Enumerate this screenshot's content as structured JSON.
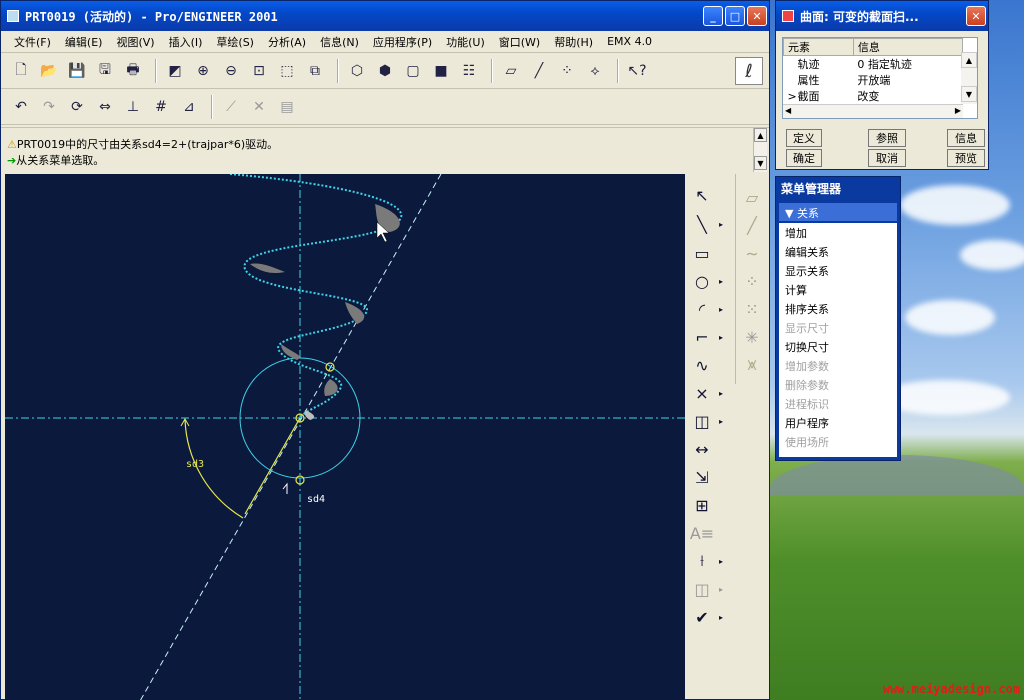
{
  "main_window": {
    "title": "PRT0019 (活动的) - Pro/ENGINEER 2001",
    "menus": [
      "文件(F)",
      "编辑(E)",
      "视图(V)",
      "插入(I)",
      "草绘(S)",
      "分析(A)",
      "信息(N)",
      "应用程序(P)",
      "功能(U)",
      "窗口(W)",
      "帮助(H)",
      "EMX 4.0"
    ],
    "messages": {
      "line1": "PRT0019中的尺寸由关系sd4=2+(trajpar*6)驱动。",
      "line2": "从关系菜单选取。"
    }
  },
  "canvas": {
    "dim_sd3": "sd3",
    "dim_sd4": "sd4"
  },
  "dialog": {
    "title": "曲面: 可变的截面扫...",
    "col_element": "元素",
    "col_info": "信息",
    "rows": [
      {
        "element": "轨迹",
        "info": "0 指定轨迹"
      },
      {
        "element": "属性",
        "info": "开放端"
      },
      {
        "element": "截面",
        "info": "改变",
        "marker": ">"
      }
    ],
    "buttons": {
      "define": "定义",
      "refs": "参照",
      "info": "信息",
      "ok": "确定",
      "cancel": "取消",
      "preview": "预览"
    }
  },
  "menu_manager": {
    "title": "菜单管理器",
    "section": "关系",
    "items": [
      {
        "label": "增加",
        "enabled": true
      },
      {
        "label": "编辑关系",
        "enabled": true
      },
      {
        "label": "显示关系",
        "enabled": true
      },
      {
        "label": "计算",
        "enabled": true
      },
      {
        "label": "排序关系",
        "enabled": true
      },
      {
        "label": "显示尺寸",
        "enabled": false
      },
      {
        "label": "切换尺寸",
        "enabled": true
      },
      {
        "label": "增加参数",
        "enabled": false
      },
      {
        "label": "删除参数",
        "enabled": false
      },
      {
        "label": "进程标识",
        "enabled": false
      },
      {
        "label": "用户程序",
        "enabled": true
      },
      {
        "label": "使用场所",
        "enabled": false
      }
    ]
  },
  "watermark": "www.meiyadesign.com",
  "colors": {
    "canvas_bg": "#0b1a3c",
    "spiral": "#3fd2e8",
    "dim": "#e8e84a"
  }
}
